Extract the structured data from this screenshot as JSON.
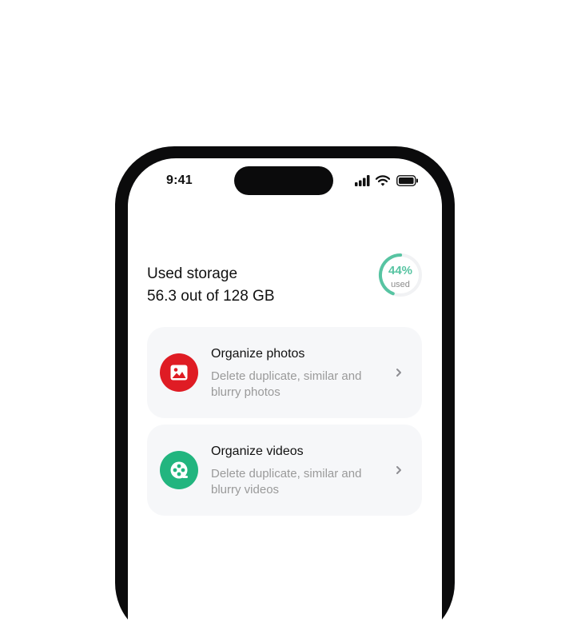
{
  "status_bar": {
    "time": "9:41",
    "icons": [
      "signal-icon",
      "wifi-icon",
      "battery-icon"
    ]
  },
  "storage": {
    "title": "Used storage",
    "value": "56.3 out of 128 GB",
    "percent_label": "44%",
    "percent_value": 44,
    "used_label": "used",
    "accent_color": "#57c4a2"
  },
  "cards": [
    {
      "title": "Organize photos",
      "description": "Delete duplicate, similar and blurry photos",
      "icon": "photo-icon",
      "icon_color": "#df1c24"
    },
    {
      "title": "Organize videos",
      "description": "Delete duplicate, similar and blurry videos",
      "icon": "film-reel-icon",
      "icon_color": "#22b57f"
    }
  ]
}
